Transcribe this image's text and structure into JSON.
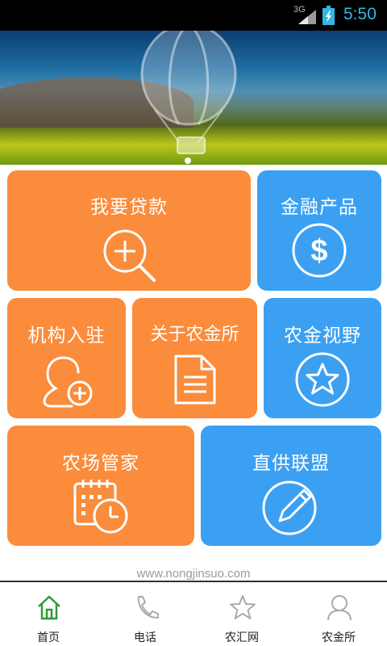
{
  "status_bar": {
    "network": "3G",
    "time": "5:50",
    "time_color": "#33b5e5"
  },
  "banner": {
    "image": "hot-air-balloon-landscape"
  },
  "tiles": [
    {
      "label": "我要贷款",
      "icon": "zoom-in-icon",
      "color": "#fa8c3c"
    },
    {
      "label": "金融产品",
      "icon": "dollar-icon",
      "color": "#3ba0f2"
    },
    {
      "label": "机构入驻",
      "icon": "add-user-icon",
      "color": "#fa8c3c"
    },
    {
      "label": "关于农金所",
      "icon": "document-icon",
      "color": "#fa8c3c"
    },
    {
      "label": "农金视野",
      "icon": "star-icon",
      "color": "#3ba0f2"
    },
    {
      "label": "农场管家",
      "icon": "calendar-clock-icon",
      "color": "#fa8c3c"
    },
    {
      "label": "直供联盟",
      "icon": "pencil-icon",
      "color": "#3ba0f2"
    }
  ],
  "footer": {
    "url": "www.nongjinsuo.com"
  },
  "bottom_nav": {
    "items": [
      {
        "label": "首页",
        "icon": "home-icon",
        "active": true
      },
      {
        "label": "电话",
        "icon": "phone-icon",
        "active": false
      },
      {
        "label": "农汇网",
        "icon": "star-icon",
        "active": false
      },
      {
        "label": "农金所",
        "icon": "user-icon",
        "active": false
      }
    ],
    "active_color": "#2e9b3a"
  }
}
